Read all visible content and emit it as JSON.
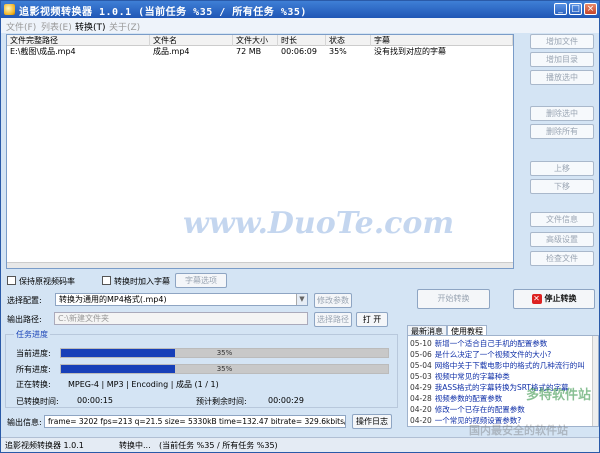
{
  "window": {
    "title": "追影视频转换器 1.0.1 (当前任务 %35 / 所有任务 %35)"
  },
  "menu": [
    {
      "label": "文件(F)",
      "active": false
    },
    {
      "label": "列表(E)",
      "active": false
    },
    {
      "label": "转换(T)",
      "active": true
    },
    {
      "label": "关于(Z)",
      "active": false
    }
  ],
  "table": {
    "headers": [
      "文件完整路径",
      "文件名",
      "文件大小",
      "时长",
      "状态",
      "字幕"
    ],
    "rows": [
      [
        "E:\\截图\\成品.mp4",
        "成品.mp4",
        "72 MB",
        "00:06:09",
        "35%",
        "没有找到对应的字幕"
      ]
    ]
  },
  "side_buttons": [
    "增加文件",
    "增加目录",
    "播放选中",
    "删除选中",
    "删除所有",
    "上移",
    "下移",
    "文件信息",
    "高级设置",
    "检查文件"
  ],
  "options": {
    "keep_bitrate": "保持原视频码率",
    "add_subtitle": "转换时加入字幕",
    "subtitle_button": "字幕选项"
  },
  "config": {
    "label": "选择配置:",
    "value": "转换为通用的MP4格式(.mp4)",
    "modify_button": "修改参数"
  },
  "output": {
    "label": "输出路径:",
    "value": "C:\\新建文件夹",
    "browse_button": "选择路径",
    "open_button": "打 开"
  },
  "actions": {
    "start": "开始转换",
    "stop": "停止转换"
  },
  "progress": {
    "legend": "任务进度",
    "current_label": "当前进度:",
    "current_value": 35,
    "current_text": "35%",
    "all_label": "所有进度:",
    "all_value": 35,
    "all_text": "35%",
    "converting_label": "正在转换:",
    "converting_value": "MPEG-4 | MP3 | Encoding | 成品 (1 / 1)",
    "elapsed_label": "已转换时间:",
    "elapsed_value": "00:00:15",
    "remaining_label": "预计剩余时间:",
    "remaining_value": "00:00:29"
  },
  "log": {
    "label": "输出信息:",
    "value": "frame= 3202 fps=213 q=21.5 size=     5330kB time=132.47 bitrate= 329.6kbits/s",
    "button": "操作日志"
  },
  "news": {
    "tabs": [
      "最新消息",
      "使用教程"
    ],
    "items": [
      {
        "date": "05-10",
        "text": "新增一个适合自己手机的配置参数"
      },
      {
        "date": "05-06",
        "text": "是什么决定了一个视频文件的大小?"
      },
      {
        "date": "05-04",
        "text": "网络中关于下载电影中的格式的几种流行的叫"
      },
      {
        "date": "05-03",
        "text": "视频中常见的字幕种类"
      },
      {
        "date": "04-29",
        "text": "我ASS格式的字幕转换为SRT格式的字幕"
      },
      {
        "date": "04-28",
        "text": "视频参数的配置参数"
      },
      {
        "date": "04-20",
        "text": "修改一个已存在的配置参数"
      },
      {
        "date": "04-20",
        "text": "一个常见的视频设置参数?"
      }
    ]
  },
  "status": {
    "app": "追影视频转换器 1.0.1",
    "state": "转换中...",
    "detail": "(当前任务 %35 / 所有任务 %35)"
  },
  "watermarks": {
    "duote": "www.DuoTe.com",
    "site": "多特软件站",
    "slogan": "国内最安全的软件站"
  },
  "colors": {
    "titlebar": "#1f56b5",
    "progress_fill": "#173fb8",
    "accent_text": "#1d46b8"
  }
}
